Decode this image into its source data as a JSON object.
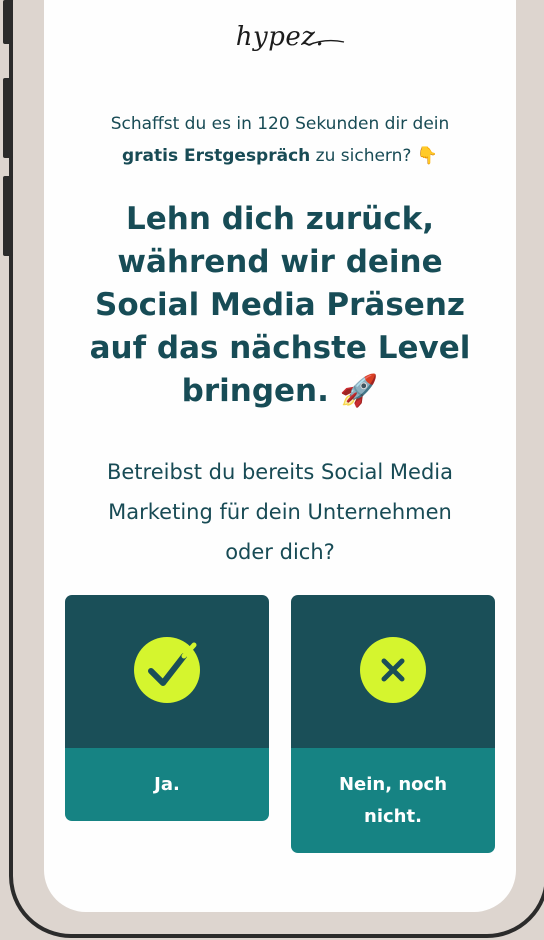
{
  "brand": {
    "logo_text": "hypez."
  },
  "intro": {
    "line1": "Schaffst du es in 120 Sekunden dir dein",
    "bold": "gratis Erstgespräch",
    "rest": " zu sichern? 👇"
  },
  "headline": {
    "line1": "Lehn dich zurück,",
    "line2": "während wir deine",
    "line3": "Social Media Präsenz",
    "line4": "auf das nächste Level",
    "line5": "bringen. 🚀"
  },
  "question": {
    "line1": "Betreibst du bereits Social Media",
    "line2": "Marketing für dein Unternehmen",
    "line3": "oder dich?"
  },
  "options": {
    "yes_label": "Ja.",
    "no_label_line1": "Nein, noch",
    "no_label_line2": "nicht.",
    "yes_icon": "check-icon",
    "no_icon": "close-icon"
  },
  "colors": {
    "primary_dark": "#1a4f58",
    "primary_teal": "#168383",
    "accent_lime": "#d5f52e",
    "text": "#184b55",
    "background": "#ddd5cf"
  }
}
